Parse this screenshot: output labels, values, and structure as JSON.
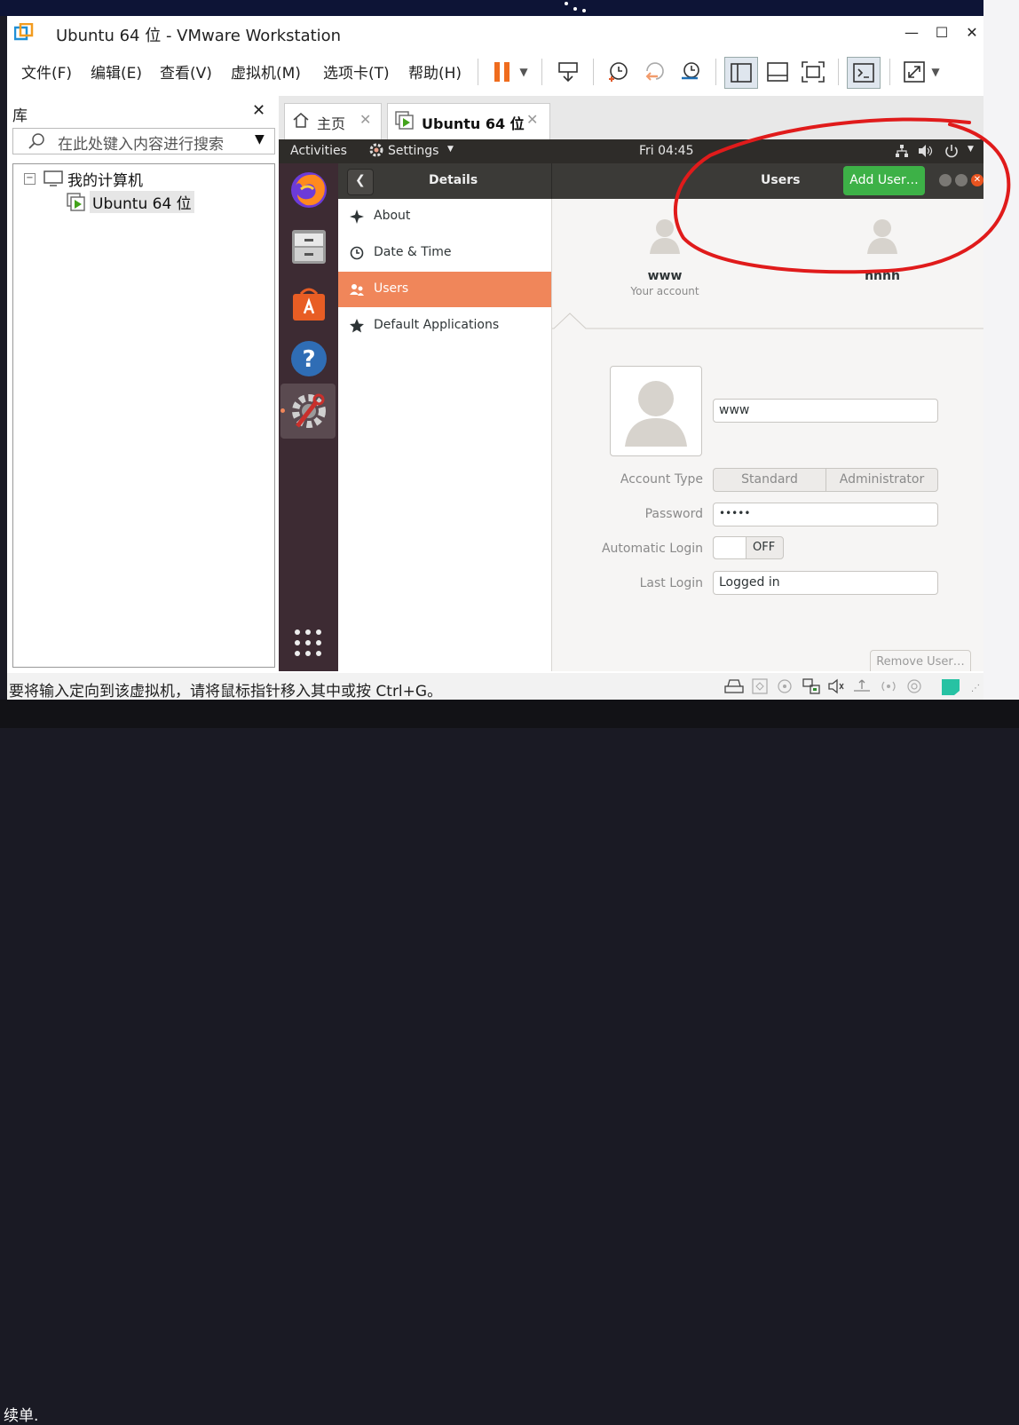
{
  "desktop": {
    "bottom_text": "续单."
  },
  "window": {
    "title": "Ubuntu 64 位 - VMware Workstation"
  },
  "menu": [
    "文件(F)",
    "编辑(E)",
    "查看(V)",
    "虚拟机(M)",
    "选项卡(T)",
    "帮助(H)"
  ],
  "library": {
    "title": "库",
    "search_placeholder": "在此处键入内容进行搜索",
    "tree_root": "我的计算机",
    "tree_child": "Ubuntu 64 位"
  },
  "tabs": [
    {
      "label": "主页"
    },
    {
      "label": "Ubuntu 64 位"
    }
  ],
  "guest": {
    "topbar": {
      "activities": "Activities",
      "settings": "Settings",
      "clock": "Fri 04:45"
    },
    "header": {
      "details": "Details",
      "users": "Users",
      "add_user": "Add User…"
    },
    "sidebar": [
      {
        "label": "About",
        "icon": "star-icon"
      },
      {
        "label": "Date & Time",
        "icon": "clock-icon"
      },
      {
        "label": "Users",
        "icon": "users-icon"
      },
      {
        "label": "Default Applications",
        "icon": "star-filled-icon"
      }
    ],
    "accounts": [
      {
        "name": "www",
        "sub": "Your account"
      },
      {
        "name": "hhhh",
        "sub": ""
      }
    ],
    "form": {
      "name_value": "www",
      "account_type_label": "Account Type",
      "account_type_options": [
        "Standard",
        "Administrator"
      ],
      "password_label": "Password",
      "password_value": "•••••",
      "autologin_label": "Automatic Login",
      "autologin_value": "OFF",
      "lastlogin_label": "Last Login",
      "lastlogin_value": "Logged in",
      "remove_user": "Remove User…"
    }
  },
  "status": {
    "text": "要将输入定向到该虚拟机，请将鼠标指针移入其中或按 Ctrl+G。"
  },
  "colors": {
    "accent": "#f0865a",
    "green": "#3db147",
    "pause": "#ef6c1e",
    "annotation": "#e01b1b",
    "dock": "#3d2b33"
  }
}
